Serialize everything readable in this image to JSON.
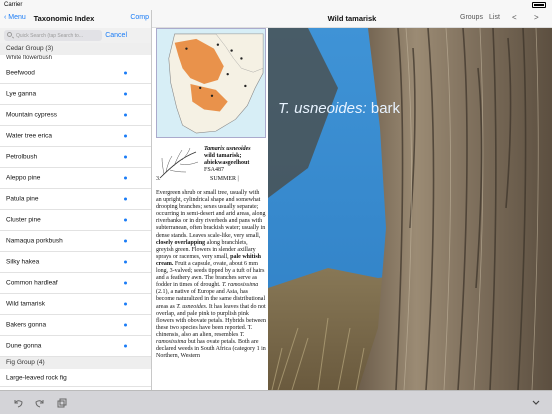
{
  "status_bar": {
    "carrier": "Carrier"
  },
  "left_pane": {
    "back_label": "Menu",
    "title": "Taxonomic Index",
    "right_action": "Comp",
    "search": {
      "placeholder": "Quick Search (tap Search to...",
      "cancel_label": "Cancel"
    },
    "header_group": "Cedar Group (3)",
    "partial_row": "White flowerbush",
    "rows": [
      {
        "label": "Beefwood"
      },
      {
        "label": "Lye ganna"
      },
      {
        "label": "Mountain cypress"
      },
      {
        "label": "Water tree erica"
      },
      {
        "label": "Petrolbush"
      },
      {
        "label": "Aleppo pine"
      },
      {
        "label": "Patula pine"
      },
      {
        "label": "Cluster pine"
      },
      {
        "label": "Namaqua porkbush"
      },
      {
        "label": "Silky hakea"
      },
      {
        "label": "Common hardleaf"
      },
      {
        "label": "Wild tamarisk"
      },
      {
        "label": "Bakers gonna"
      },
      {
        "label": "Dune gonna"
      }
    ],
    "group2": "Fig Group (4)",
    "after_group2": "Large-leaved rock fig"
  },
  "right_pane": {
    "title": "Wild tamarisk",
    "groups_label": "Groups",
    "list_label": "List",
    "prev_label": "<",
    "next_label": ">",
    "entry": {
      "scientific_name": "Tamarix usneoides",
      "common_names": "wild tamarisk; abiekwasgeelhout",
      "code": "FSA487",
      "season": "SUMMER |",
      "number": "3.",
      "body_1": "Evergreen shrub or small tree, usually with an upright, cylindrical shape and somewhat drooping branches; sexes usually separate; occurring in semi-desert and arid areas, along riverbanks or in dry riverbeds and pans with subterranean, often brackish water; usually in dense stands. Leaves scale-like, very small,",
      "bold_1": "closely overlapping",
      "body_2": "along branchlets, greyish green. Flowers in slender axillary sprays or racemes, very small,",
      "bold_2": "pale whitish cream.",
      "body_3": "Fruit a capsule, ovate, about 6 mm long, 3-valved; seeds tipped by a tuft of hairs and a feathery awn. The branches serve as fodder in times of drought.",
      "italic_1": "T. ramosissima",
      "body_4": "(2.1), a native of Europe and Asia, has become naturalized in the same distributional areas as",
      "italic_2": "T. usneoides.",
      "body_5": "It has leaves that do not overlap, and pale pink to purplish pink flowers with obovate petals. Hybrids between these two species have been reported. T. chinensis, also an alien, resembles",
      "italic_3": "T. ramosissima",
      "body_6": "but has ovate petals. Both are declared weeds in South Africa (category 1 in Northern, Western"
    },
    "photo_caption_species": "T. usneoides:",
    "photo_caption_part": "bark"
  },
  "colors": {
    "accent": "#1a7cf6",
    "distribution": "#e8873a"
  }
}
